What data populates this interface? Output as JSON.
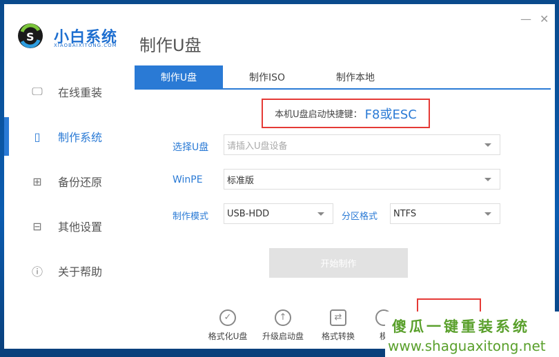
{
  "app": {
    "brand": "小白系统",
    "brand_sub": "XIAOBAIXITONG.COM",
    "title": "制作U盘"
  },
  "sidebar": {
    "items": [
      {
        "label": "在线重装",
        "icon": "monitor-icon"
      },
      {
        "label": "制作系统",
        "icon": "usb-icon",
        "active": true
      },
      {
        "label": "备份还原",
        "icon": "grid-icon"
      },
      {
        "label": "其他设置",
        "icon": "briefcase-icon"
      },
      {
        "label": "关于帮助",
        "icon": "info-icon"
      }
    ]
  },
  "tabs": [
    {
      "label": "制作U盘",
      "active": true
    },
    {
      "label": "制作ISO"
    },
    {
      "label": "制作本地"
    }
  ],
  "hotkey": {
    "label": "本机U盘启动快捷键：",
    "value": "F8或ESC"
  },
  "form": {
    "usb_label": "选择U盘",
    "usb_placeholder": "请插入U盘设备",
    "winpe_label": "WinPE",
    "winpe_value": "标准版",
    "mode_label": "制作模式",
    "mode_value": "USB-HDD",
    "fs_label": "分区格式",
    "fs_value": "NTFS",
    "start_label": "开始制作"
  },
  "tools": [
    {
      "label": "格式化U盘",
      "icon": "check-circle-icon"
    },
    {
      "label": "升级启动盘",
      "icon": "arrow-up-circle-icon"
    },
    {
      "label": "格式转换",
      "icon": "convert-icon"
    },
    {
      "label": "模",
      "icon": "partial-icon"
    }
  ],
  "watermark": {
    "line1": "傻瓜一键重装系统",
    "line2": "www.shaguaxitong.net"
  },
  "colors": {
    "accent": "#2a7ad5",
    "highlight": "#e53935",
    "watermark": "#5aa02c"
  }
}
